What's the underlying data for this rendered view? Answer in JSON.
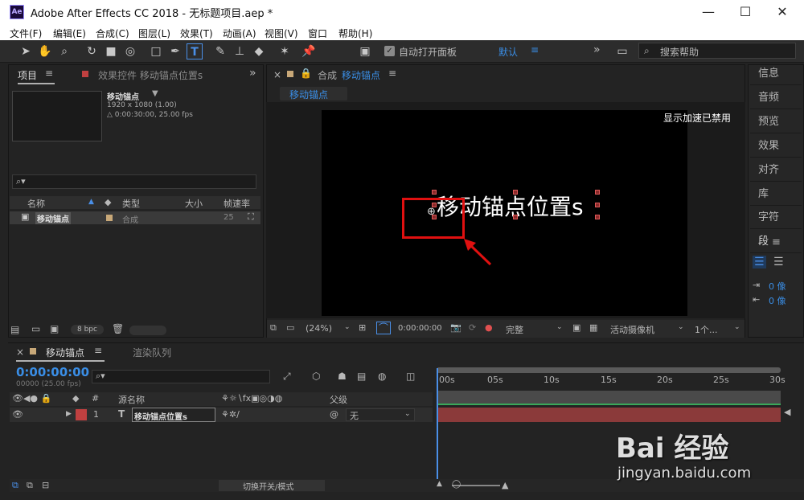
{
  "window": {
    "title": "Adobe After Effects CC 2018 - 无标题项目.aep *",
    "app_icon_text": "Ae",
    "controls": [
      "—",
      "☐",
      "✕"
    ]
  },
  "menu": [
    "文件(F)",
    "编辑(E)",
    "合成(C)",
    "图层(L)",
    "效果(T)",
    "动画(A)",
    "视图(V)",
    "窗口",
    "帮助(H)"
  ],
  "toolbar": {
    "auto_open_panel_label": "自动打开面板",
    "workspace_label": "默认",
    "search_placeholder": "搜索帮助"
  },
  "project_panel": {
    "tab_label": "项目",
    "effects_tab_label": "效果控件 移动锚点位置s",
    "comp_name": "移动锚点",
    "comp_size": "1920 x 1080 (1.00)",
    "comp_duration": "△ 0:00:30:00, 25.00 fps",
    "columns": [
      "名称",
      "类型",
      "大小",
      "帧速率"
    ],
    "item": {
      "name": "移动锚点",
      "type": "合成",
      "fps": "25"
    },
    "bpc_label": "8 bpc"
  },
  "comp_viewer": {
    "tab_prefix": "合成",
    "tab_name": "移动锚点",
    "breadcrumb": "移动锚点",
    "accel_notice": "显示加速已禁用",
    "text_layer_content": "移动锚点位置s",
    "zoom": "(24%)",
    "timecode": "0:00:00:00",
    "resolution": "完整",
    "camera": "活动摄像机",
    "views": "1个..."
  },
  "right_panel": {
    "items": [
      "信息",
      "音频",
      "预览",
      "效果",
      "对齐",
      "库",
      "字符",
      "段"
    ],
    "para_values": [
      "0 像",
      "0 像"
    ]
  },
  "timeline": {
    "tab_label": "移动锚点",
    "render_queue_label": "渲染队列",
    "timecode": "0:00:00:00",
    "timecode_sub": "00000 (25.00 fps)",
    "columns": {
      "num": "#",
      "source_name": "源名称",
      "parent": "父级"
    },
    "layer": {
      "index": "1",
      "type": "T",
      "name": "移动锚点位置s",
      "parent": "无"
    },
    "ruler_labels": [
      "00s",
      "05s",
      "10s",
      "15s",
      "20s",
      "25s",
      "30s"
    ],
    "toggle_label": "切换开关/模式"
  },
  "watermark": {
    "brand": "Bai 经验",
    "url": "jingyan.baidu.com"
  }
}
